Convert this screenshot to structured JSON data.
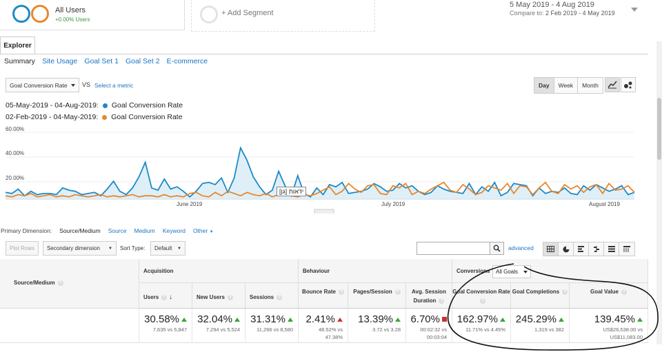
{
  "segments": {
    "all_users_label": "All Users",
    "all_users_sub": "+0.00% Users",
    "add_segment": "+ Add Segment",
    "colors": {
      "primary": "#1a8ac7",
      "compare": "#e9862a"
    }
  },
  "date_range": {
    "main": "5 May 2019 - 4 Aug 2019",
    "compare_prefix": "Compare to:",
    "compare": "2 Feb 2019 - 4 May 2019"
  },
  "tabs": {
    "explorer": "Explorer"
  },
  "subtabs": [
    "Summary",
    "Site Usage",
    "Goal Set 1",
    "Goal Set 2",
    "E-commerce"
  ],
  "metric_controls": {
    "metric": "Goal Conversion Rate",
    "vs": "VS",
    "select_metric": "Select a metric",
    "granularity": [
      "Day",
      "Week",
      "Month"
    ],
    "active_granularity": "Day"
  },
  "legend": [
    {
      "range": "05-May-2019 - 04-Aug-2019:",
      "metric": "Goal Conversion Rate",
      "color": "#1a8ac7"
    },
    {
      "range": "02-Feb-2019 - 04-May-2019:",
      "metric": "Goal Conversion Rate",
      "color": "#e9862a"
    }
  ],
  "chart_data": {
    "type": "line",
    "yticks": [
      "60.00%",
      "40.00%",
      "20.00%"
    ],
    "ylim": [
      0,
      60
    ],
    "xticks": [
      "June 2019",
      "July 2019",
      "August 2019"
    ],
    "tooltip": "[גן] ידאות",
    "series": [
      {
        "name": "05-May-2019 - 04-Aug-2019",
        "color": "#1a8ac7",
        "area": true,
        "values": [
          6,
          5,
          9,
          3,
          7,
          4,
          5,
          5,
          4,
          10,
          8,
          7,
          4,
          5,
          6,
          3,
          9,
          16,
          7,
          4,
          10,
          20,
          33,
          10,
          8,
          18,
          9,
          11,
          7,
          2,
          7,
          14,
          15,
          13,
          19,
          6,
          19,
          46,
          35,
          20,
          11,
          4,
          8,
          25,
          12,
          3,
          21,
          5,
          2,
          10,
          4,
          13,
          11,
          15,
          5,
          6,
          7,
          9,
          14,
          11,
          7,
          8,
          14,
          10,
          12,
          7,
          4,
          6,
          12,
          9,
          7,
          6,
          5,
          14,
          4,
          11,
          7,
          15,
          3,
          6,
          14,
          13,
          12,
          3,
          10,
          5,
          7,
          6,
          10,
          5,
          4,
          12,
          8,
          13,
          10,
          7,
          9,
          12,
          4,
          6
        ]
      },
      {
        "name": "02-Feb-2019 - 04-May-2019",
        "color": "#e9862a",
        "area": false,
        "values": [
          3,
          2,
          4,
          3,
          5,
          2,
          3,
          4,
          2,
          3,
          2,
          4,
          3,
          2,
          3,
          4,
          2,
          3,
          2,
          3,
          4,
          2,
          3,
          3,
          2,
          4,
          2,
          3,
          2,
          5,
          6,
          3,
          2,
          6,
          3,
          7,
          5,
          3,
          6,
          4,
          3,
          5,
          2,
          4,
          6,
          3,
          2,
          4,
          3,
          5,
          8,
          11,
          4,
          7,
          14,
          9,
          6,
          12,
          13,
          5,
          4,
          12,
          10,
          14,
          4,
          7,
          5,
          9,
          12,
          15,
          8,
          6,
          13,
          9,
          4,
          6,
          12,
          10,
          8,
          14,
          5,
          12,
          11,
          4,
          10,
          15,
          7,
          5,
          13,
          9,
          12,
          6,
          11,
          13,
          5,
          14,
          8,
          9,
          12,
          6
        ]
      }
    ]
  },
  "primary_dimension": {
    "label": "Primary Dimension:",
    "options": [
      "Source/Medium",
      "Source",
      "Medium",
      "Keyword",
      "Other"
    ],
    "active": "Source/Medium"
  },
  "toolbar": {
    "plot_rows": "Plot Rows",
    "secondary": "Secondary dimension",
    "sort_type_label": "Sort Type:",
    "sort_type": "Default",
    "advanced": "advanced",
    "search_value": ""
  },
  "table": {
    "dim_header": "Source/Medium",
    "groups": {
      "acquisition": "Acquisition",
      "behaviour": "Behaviour",
      "conversions": "Conversions",
      "goal_select": "All Goals"
    },
    "columns": [
      {
        "label": "Users",
        "pct": "30.58%",
        "cmp": [
          "7,635 vs 5,847"
        ],
        "dir": "up"
      },
      {
        "label": "New Users",
        "pct": "32.04%",
        "cmp": [
          "7,294 vs 5,524"
        ],
        "dir": "up"
      },
      {
        "label": "Sessions",
        "pct": "31.31%",
        "cmp": [
          "11,266 vs 8,580"
        ],
        "dir": "up"
      },
      {
        "label": "Bounce Rate",
        "pct": "2.41%",
        "cmp": [
          "48.52% vs",
          "47.38%"
        ],
        "dir": "up-bad"
      },
      {
        "label": "Pages/Session",
        "pct": "13.39%",
        "cmp": [
          "3.72 vs 3.28"
        ],
        "dir": "up"
      },
      {
        "label": "Avg. Session Duration",
        "pct": "6.70%",
        "cmp": [
          "00:02:32 vs",
          "00:03:04"
        ],
        "dir": "down"
      },
      {
        "label": "Goal Conversion Rate",
        "pct": "162.97%",
        "cmp": [
          "11.71% vs 4.45%"
        ],
        "dir": "up"
      },
      {
        "label": "Goal Completions",
        "pct": "245.29%",
        "cmp": [
          "1,319 vs 382"
        ],
        "dir": "up"
      },
      {
        "label": "Goal Value",
        "pct": "139.45%",
        "cmp": [
          "US$26,538.00 vs",
          "US$11,083.00"
        ],
        "dir": "up"
      }
    ]
  }
}
